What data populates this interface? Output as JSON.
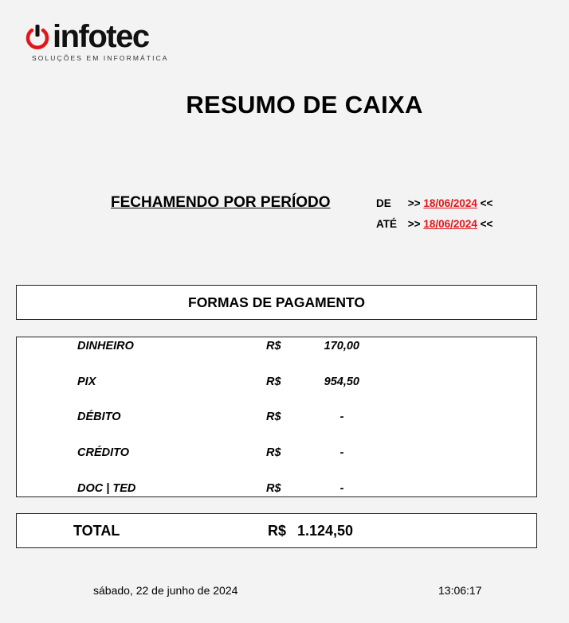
{
  "logo": {
    "wordmark": "infotec",
    "tagline": "SOLUÇÕES EM INFORMÁTICA",
    "colors": {
      "accent": "#e0161b",
      "text": "#111111"
    }
  },
  "title": "RESUMO DE CAIXA",
  "period": {
    "label": "FECHAMENDO POR PERÍODO",
    "from_label": "DE",
    "to_label": "ATÉ",
    "arrow_left": ">>",
    "arrow_right": "<<",
    "from_date": "18/06/2024",
    "to_date": "18/06/2024",
    "date_color": "#e0161b"
  },
  "forms": {
    "header": "FORMAS DE PAGAMENTO",
    "rows": [
      {
        "name": "DINHEIRO",
        "currency": "R$",
        "value": "170,00"
      },
      {
        "name": "PIX",
        "currency": "R$",
        "value": "954,50"
      },
      {
        "name": "DÉBITO",
        "currency": "R$",
        "value": "-"
      },
      {
        "name": "CRÉDITO",
        "currency": "R$",
        "value": "-"
      },
      {
        "name": "DOC | TED",
        "currency": "R$",
        "value": "-"
      }
    ]
  },
  "total": {
    "label": "TOTAL",
    "currency": "R$",
    "value": "1.124,50"
  },
  "footer": {
    "date": "sábado, 22 de junho de 2024",
    "time": "13:06:17"
  }
}
